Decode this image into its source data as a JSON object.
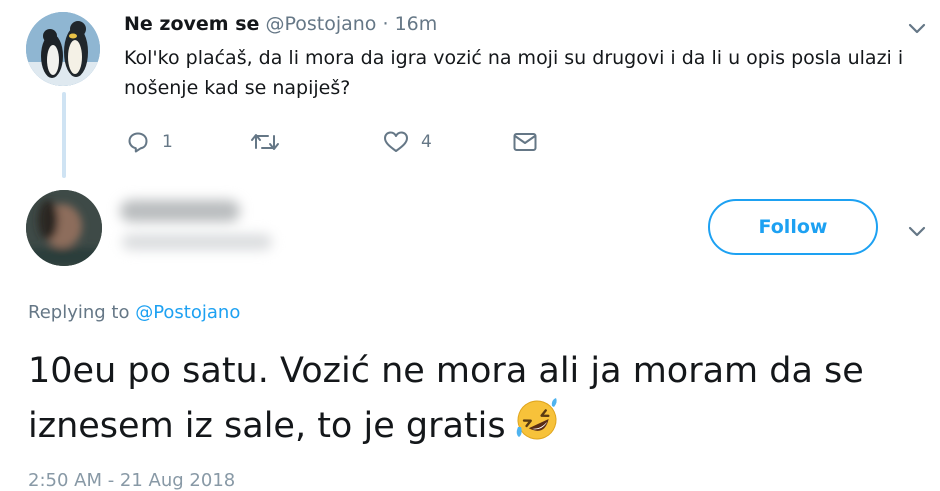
{
  "tweet1": {
    "name": "Ne zovem se",
    "handle": "@Postojano",
    "dot": "·",
    "time": "16m",
    "text": "Kol'ko plaćaš, da li mora da igra vozić na moji su drugovi i da li u opis posla ulazi i nošenje kad se napiješ?",
    "reply_count": "1",
    "like_count": "4"
  },
  "tweet2": {
    "follow_label": "Follow",
    "replying_prefix": "Replying to ",
    "replying_mention": "@Postojano",
    "text": "10eu po satu. Vozić ne mora ali ja moram da se iznesem iz sale, to je gratis",
    "timestamp": "2:50 AM - 21 Aug 2018"
  },
  "colors": {
    "accent": "#1da1f2",
    "secondary_text": "#657786",
    "thread_line": "#cfe3f3"
  },
  "icons": [
    "reply-icon",
    "retweet-icon",
    "heart-icon",
    "direct-message-icon",
    "chevron-down-icon",
    "rolling-laughing-emoji"
  ]
}
